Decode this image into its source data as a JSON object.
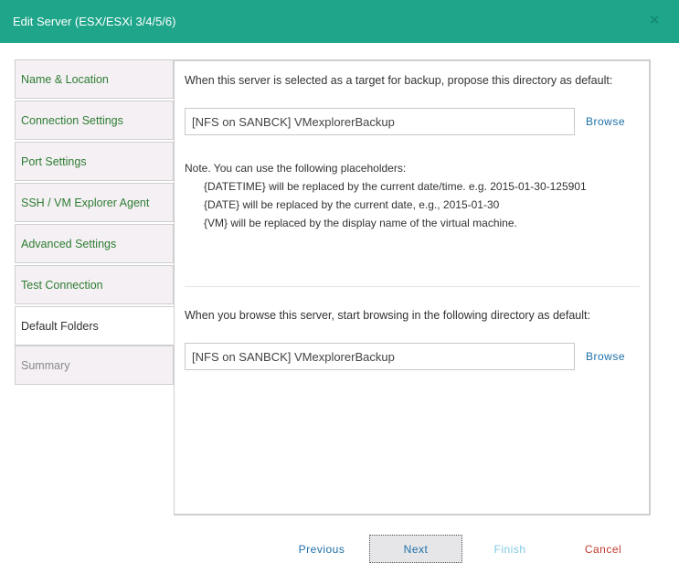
{
  "dialog": {
    "title": "Edit Server (ESX/ESXi 3/4/5/6)",
    "close_glyph": "×"
  },
  "nav": {
    "items": [
      {
        "label": "Name & Location"
      },
      {
        "label": "Connection Settings"
      },
      {
        "label": "Port Settings"
      },
      {
        "label": "SSH / VM Explorer Agent"
      },
      {
        "label": "Advanced Settings"
      },
      {
        "label": "Test Connection"
      },
      {
        "label": "Default Folders"
      },
      {
        "label": "Summary"
      }
    ],
    "active": "Default Folders"
  },
  "content": {
    "backup_prompt": "When this server is selected as a target for backup, propose this directory as default:",
    "backup_dir_value": "[NFS on SANBCK] VMexplorerBackup",
    "browse_label": "Browse",
    "note_title": "Note. You can use the following placeholders:",
    "placeholders": [
      "{DATETIME} will be replaced by the current date/time. e.g. 2015-01-30-125901",
      "{DATE} will be replaced by the current date, e.g., 2015-01-30",
      "{VM} will be replaced by the display name of the virtual machine."
    ],
    "browse_prompt": "When you browse this server, start browsing in the following directory as default:",
    "browse_dir_value": "[NFS on SANBCK] VMexplorerBackup"
  },
  "footer": {
    "previous": "Previous",
    "next": "Next",
    "finish": "Finish",
    "cancel": "Cancel"
  },
  "colors": {
    "titlebar": "#1ea58a",
    "nav_text": "#2e7d32",
    "link": "#1d6fa8",
    "cancel": "#c0392b",
    "finish_disabled": "#7fc9e3"
  }
}
